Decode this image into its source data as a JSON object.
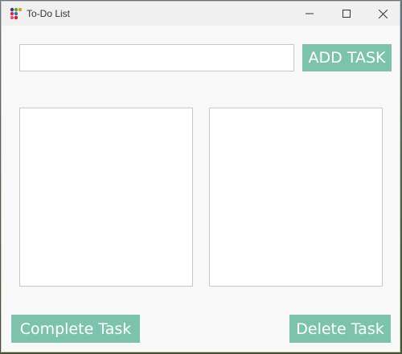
{
  "window": {
    "title": "To-Do List",
    "controls": {
      "minimize": "minimize-icon",
      "maximize": "maximize-icon",
      "close": "close-icon"
    }
  },
  "input": {
    "value": "",
    "placeholder": ""
  },
  "buttons": {
    "add_task": "ADD TASK",
    "complete_task": "Complete Task",
    "delete_task": "Delete Task"
  },
  "lists": {
    "left_items": [],
    "right_items": []
  },
  "colors": {
    "accent": "#7cc2ad",
    "button_text": "#ffffff",
    "window_bg": "#f8f8f8",
    "titlebar_bg": "#f0f0f0"
  }
}
